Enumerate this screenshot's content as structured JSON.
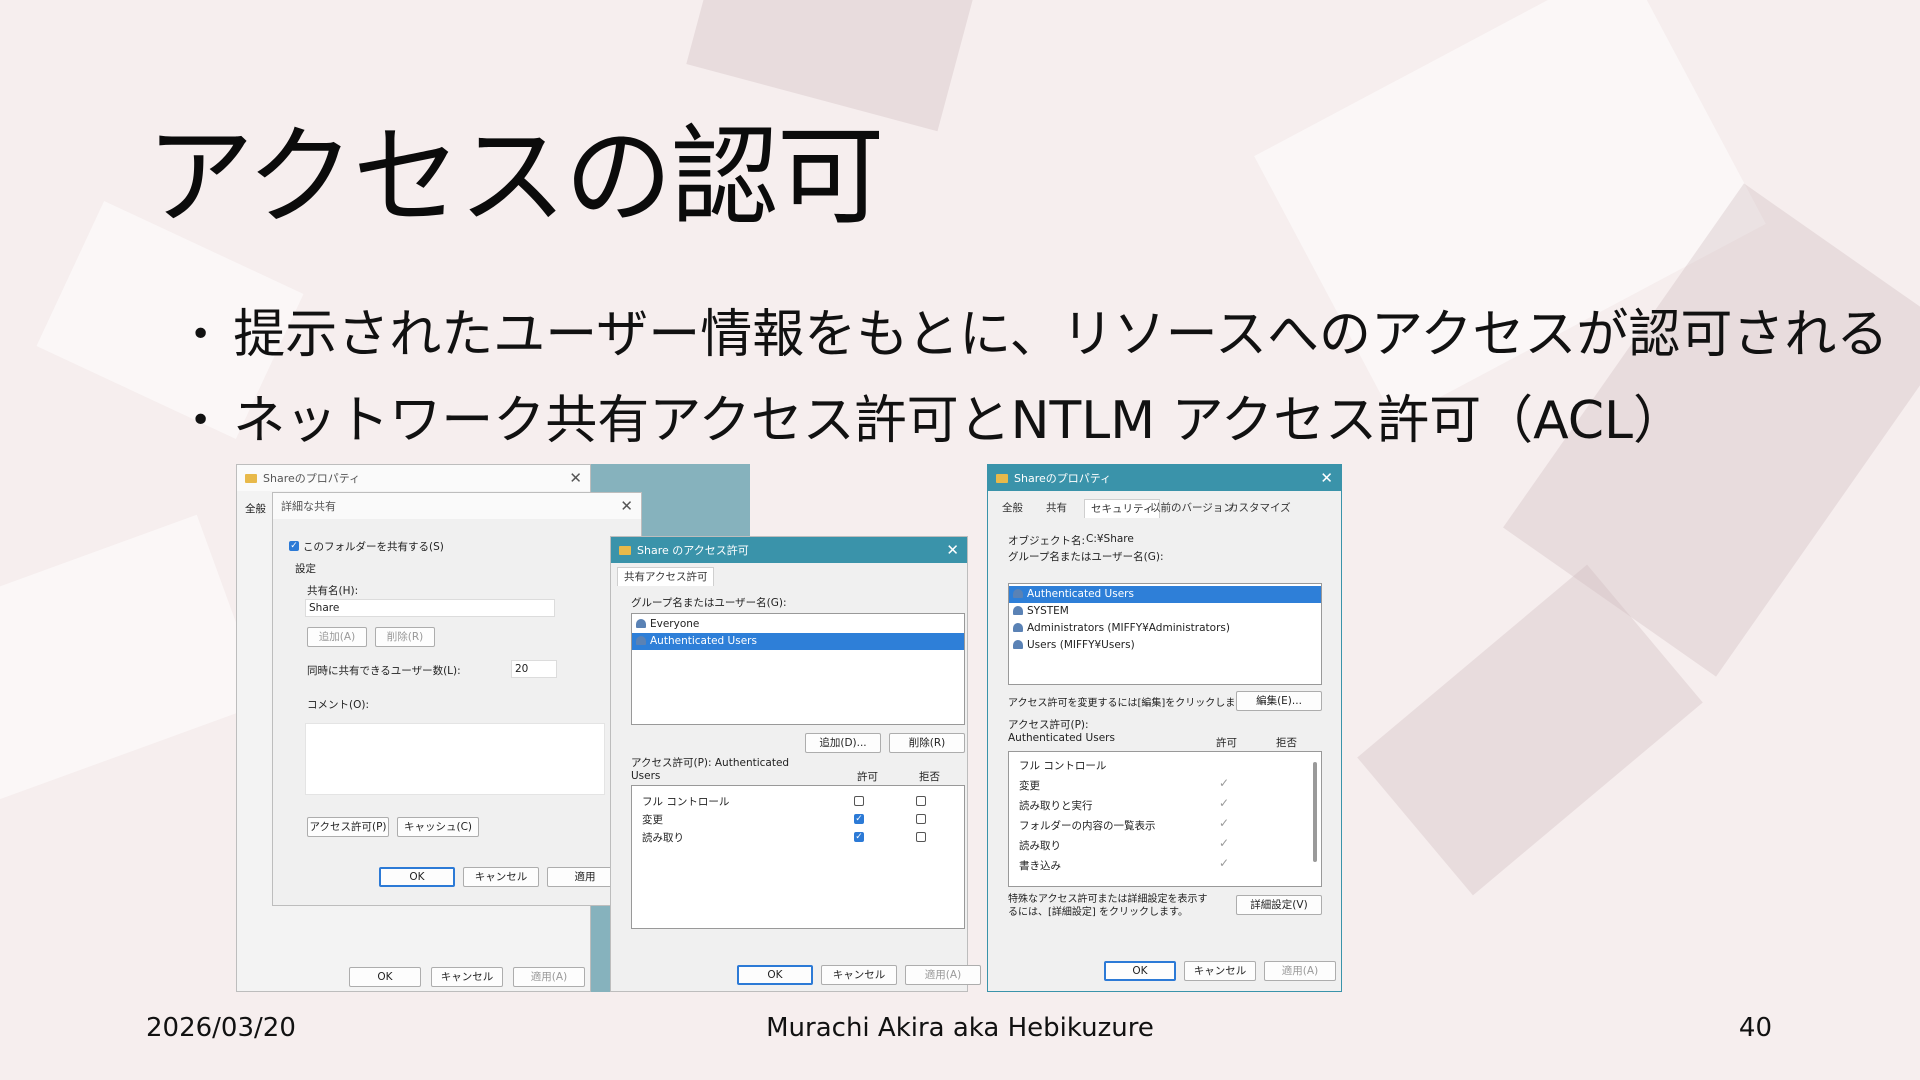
{
  "slide": {
    "title": "アクセスの認可",
    "bullets": [
      "提示されたユーザー情報をもとに、リソースへのアクセスが認可される",
      "ネットワーク共有アクセス許可とNTLM アクセス許可（ACL）"
    ],
    "footer": {
      "date": "2026/03/20",
      "author": "Murachi Akira aka Hebikuzure",
      "page": "40"
    }
  },
  "props_back": {
    "title": "Shareのプロパティ",
    "tab_general": "全般",
    "ok": "OK",
    "cancel": "キャンセル",
    "apply": "適用(A)"
  },
  "advanced_share": {
    "title": "詳細な共有",
    "share_checkbox": "このフォルダーを共有する(S)",
    "group": "設定",
    "share_name_label": "共有名(H):",
    "share_name_value": "Share",
    "add": "追加(A)",
    "remove": "削除(R)",
    "user_limit_label": "同時に共有できるユーザー数(L):",
    "user_limit_value": "20",
    "comment_label": "コメント(O):",
    "permissions_button": "アクセス許可(P)",
    "caching_button": "キャッシュ(C)",
    "ok": "OK",
    "cancel": "キャンセル",
    "apply": "適用"
  },
  "share_perm": {
    "title": "Share のアクセス許可",
    "tab": "共有アクセス許可",
    "group_label": "グループ名またはユーザー名(G):",
    "users": [
      "Everyone",
      "Authenticated Users"
    ],
    "selected_user": "Authenticated Users",
    "add": "追加(D)...",
    "remove": "削除(R)",
    "perm_label": "アクセス許可(P): Authenticated Users",
    "allow": "許可",
    "deny": "拒否",
    "permissions": [
      {
        "name": "フル コントロール",
        "allow": false,
        "deny": false
      },
      {
        "name": "変更",
        "allow": true,
        "deny": false
      },
      {
        "name": "読み取り",
        "allow": true,
        "deny": false
      }
    ],
    "ok": "OK",
    "cancel": "キャンセル",
    "apply": "適用(A)"
  },
  "security": {
    "title": "Shareのプロパティ",
    "tabs": [
      "全般",
      "共有",
      "セキュリティ",
      "以前のバージョン",
      "カスタマイズ"
    ],
    "active_tab": "セキュリティ",
    "object_label": "オブジェクト名:",
    "object_value": "C:¥Share",
    "group_label": "グループ名またはユーザー名(G):",
    "users": [
      "Authenticated Users",
      "SYSTEM",
      "Administrators (MIFFY¥Administrators)",
      "Users (MIFFY¥Users)"
    ],
    "selected_user": "Authenticated Users",
    "change_hint": "アクセス許可を変更するには[編集]をクリックします。",
    "edit_button": "編集(E)...",
    "perm_label": "アクセス許可(P): Authenticated Users",
    "allow": "許可",
    "deny": "拒否",
    "permissions": [
      {
        "name": "フル コントロール",
        "allow": false
      },
      {
        "name": "変更",
        "allow": true
      },
      {
        "name": "読み取りと実行",
        "allow": true
      },
      {
        "name": "フォルダーの内容の一覧表示",
        "allow": true
      },
      {
        "name": "読み取り",
        "allow": true
      },
      {
        "name": "書き込み",
        "allow": true
      }
    ],
    "special_hint": "特殊なアクセス許可または詳細設定を表示するには、[詳細設定] をクリックします。",
    "advanced_button": "詳細設定(V)",
    "ok": "OK",
    "cancel": "キャンセル",
    "apply": "適用(A)"
  }
}
